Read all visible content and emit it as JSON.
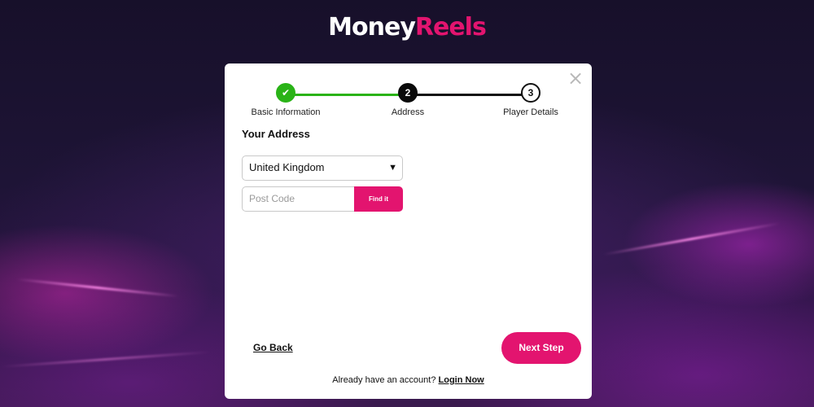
{
  "brand": {
    "part1": "Money",
    "part2": "Reels"
  },
  "colors": {
    "accent": "#e3146f",
    "success": "#2ab317",
    "background": "#1e1436"
  },
  "modal": {
    "close_icon": "×",
    "steps": [
      {
        "icon": "✔",
        "label": "Basic Information",
        "state": "complete"
      },
      {
        "icon": "2",
        "label": "Address",
        "state": "current"
      },
      {
        "icon": "3",
        "label": "Player Details",
        "state": "upcoming"
      }
    ],
    "section_title": "Your Address",
    "country": {
      "value": "United Kingdom",
      "arrow": "▼"
    },
    "postcode": {
      "placeholder": "Post Code"
    },
    "find_button": "Find it",
    "go_back": "Go Back",
    "next_step": "Next Step",
    "footer": {
      "text": "Already have an account?",
      "link": "Login Now"
    }
  }
}
